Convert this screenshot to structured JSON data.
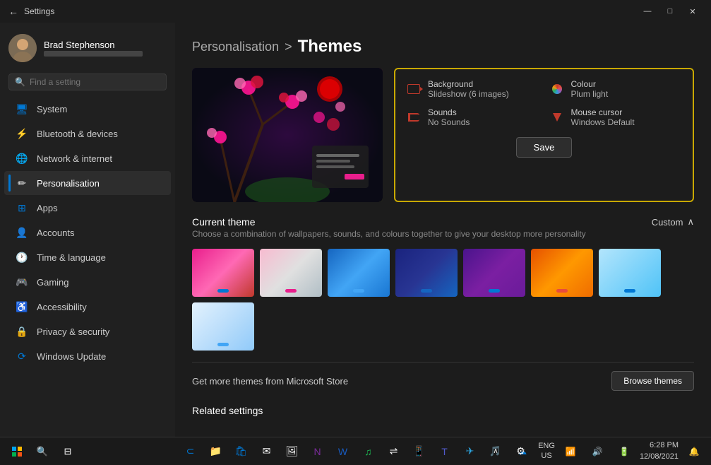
{
  "titlebar": {
    "title": "Settings",
    "back_label": "←",
    "min_label": "—",
    "max_label": "□",
    "close_label": "✕"
  },
  "sidebar": {
    "user": {
      "name": "Brad Stephenson",
      "email_placeholder": "email"
    },
    "search": {
      "placeholder": "Find a setting"
    },
    "nav_items": [
      {
        "id": "system",
        "label": "System",
        "icon": "monitor-icon",
        "glyph": "🖥"
      },
      {
        "id": "bluetooth",
        "label": "Bluetooth & devices",
        "icon": "bluetooth-icon",
        "glyph": "⚡"
      },
      {
        "id": "network",
        "label": "Network & internet",
        "icon": "wifi-icon",
        "glyph": "🌐"
      },
      {
        "id": "personalisation",
        "label": "Personalisation",
        "icon": "brush-icon",
        "glyph": "✏",
        "active": true
      },
      {
        "id": "apps",
        "label": "Apps",
        "icon": "apps-icon",
        "glyph": "⊞"
      },
      {
        "id": "accounts",
        "label": "Accounts",
        "icon": "user-icon",
        "glyph": "👤"
      },
      {
        "id": "time",
        "label": "Time & language",
        "icon": "clock-icon",
        "glyph": "🕐"
      },
      {
        "id": "gaming",
        "label": "Gaming",
        "icon": "gamepad-icon",
        "glyph": "🎮"
      },
      {
        "id": "accessibility",
        "label": "Accessibility",
        "icon": "access-icon",
        "glyph": "♿"
      },
      {
        "id": "privacy",
        "label": "Privacy & security",
        "icon": "privacy-icon",
        "glyph": "🔒"
      },
      {
        "id": "update",
        "label": "Windows Update",
        "icon": "update-icon",
        "glyph": "⟳"
      }
    ]
  },
  "content": {
    "breadcrumb_parent": "Personalisation",
    "breadcrumb_sep": ">",
    "breadcrumb_current": "Themes",
    "theme_info_box": {
      "background_label": "Background",
      "background_value": "Slideshow (6 images)",
      "sounds_label": "Sounds",
      "sounds_value": "No Sounds",
      "colour_label": "Colour",
      "colour_value": "Plum light",
      "cursor_label": "Mouse cursor",
      "cursor_value": "Windows Default",
      "save_label": "Save"
    },
    "current_theme_section": {
      "title": "Current theme",
      "description": "Choose a combination of wallpapers, sounds, and colours together to give your desktop more personality",
      "action_label": "Custom",
      "themes": [
        {
          "id": "t1",
          "color": "t1",
          "indicator": "ind-blue"
        },
        {
          "id": "t2",
          "color": "t2",
          "indicator": "ind-pink"
        },
        {
          "id": "t3",
          "color": "t3",
          "indicator": "ind-lblue"
        },
        {
          "id": "t4",
          "color": "t4",
          "indicator": "ind-navy"
        },
        {
          "id": "t5",
          "color": "t5",
          "indicator": "ind-blue"
        },
        {
          "id": "t6",
          "color": "t6",
          "indicator": "ind-red"
        },
        {
          "id": "t7",
          "color": "t7",
          "indicator": "ind-blue"
        },
        {
          "id": "t8",
          "color": "t8",
          "indicator": "ind-lblue"
        }
      ]
    },
    "store_section": {
      "text": "Get more themes from Microsoft Store",
      "browse_label": "Browse themes"
    },
    "related_section": {
      "title": "Related settings"
    }
  },
  "taskbar": {
    "time": "6:28 PM",
    "date": "12/08/2021",
    "lang_line1": "ENG",
    "lang_line2": "US"
  }
}
